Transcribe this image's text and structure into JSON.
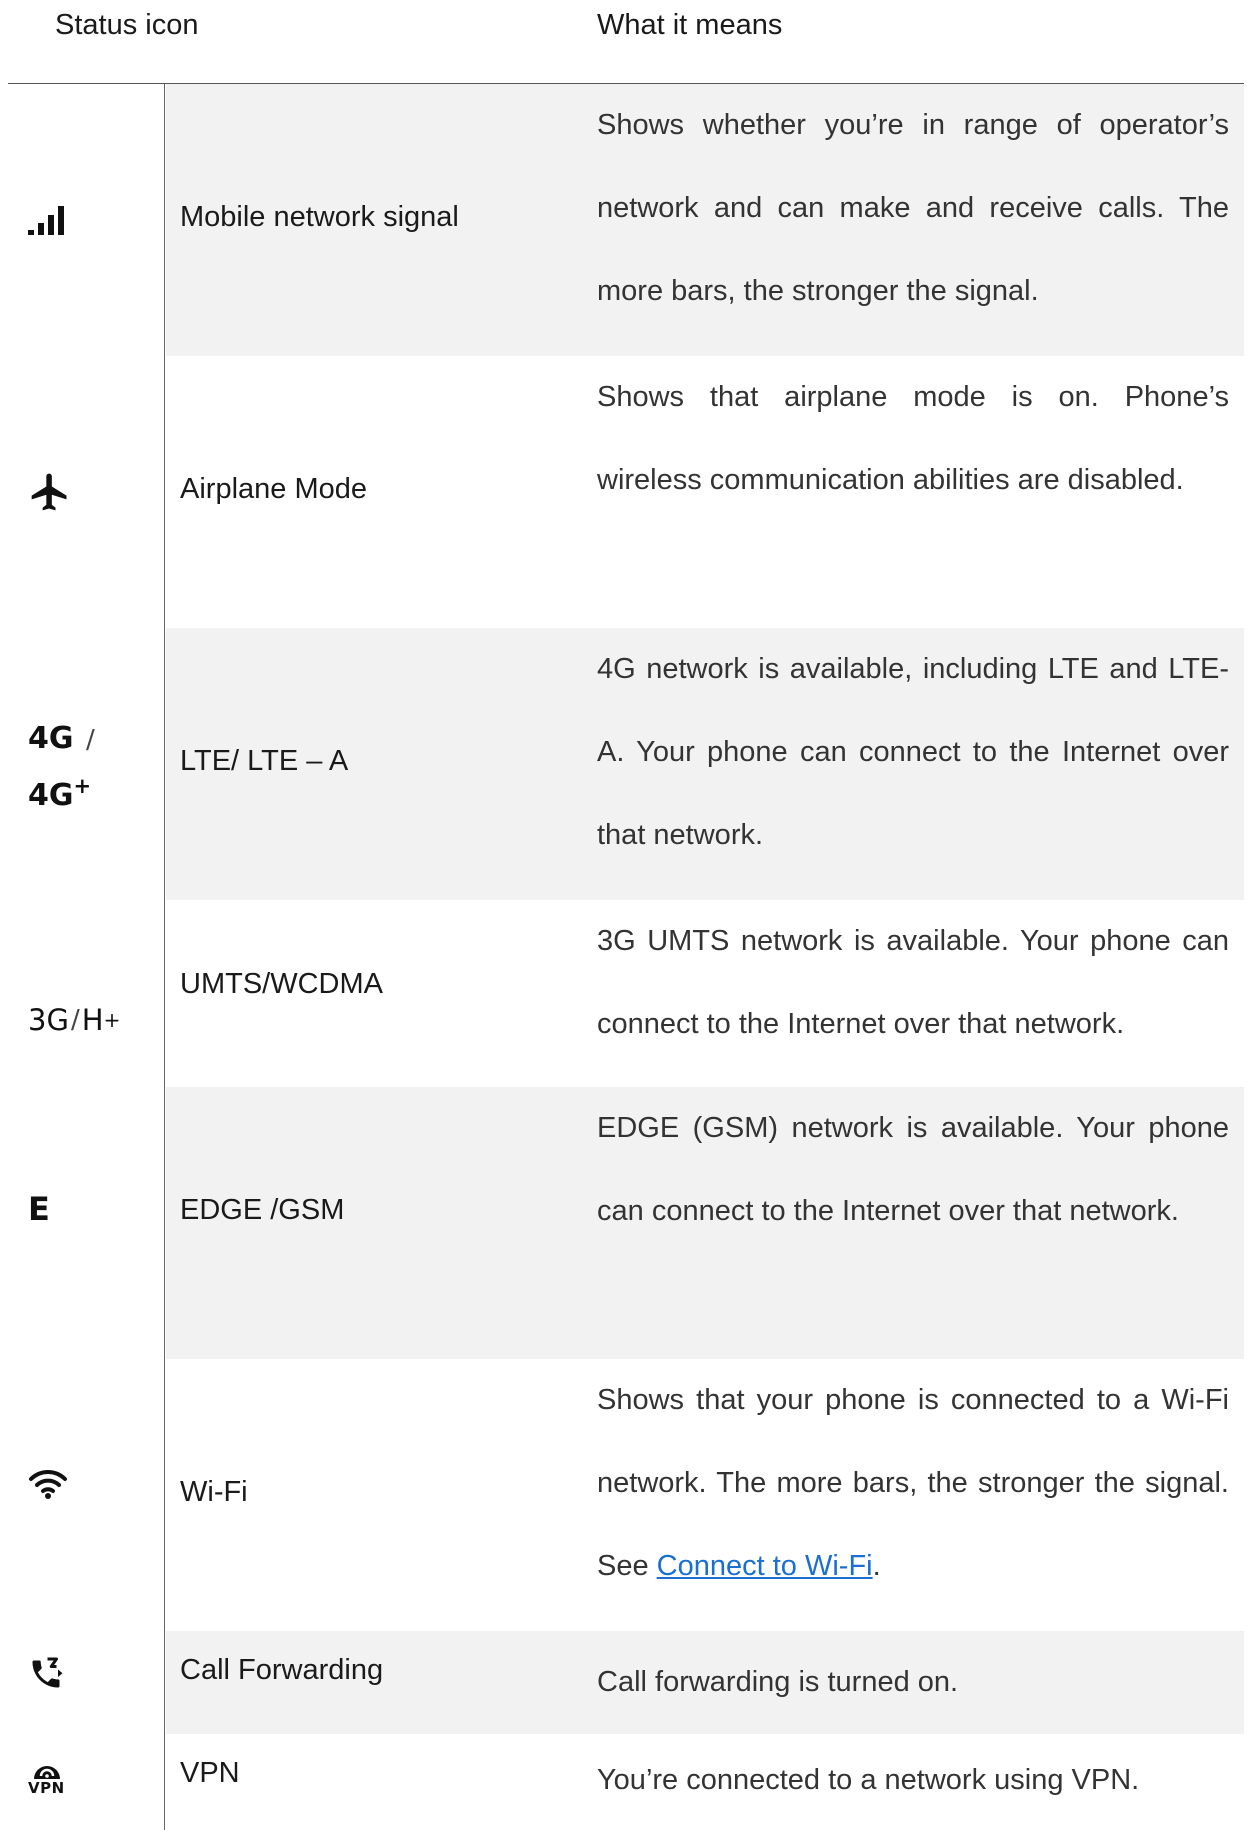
{
  "table": {
    "header": {
      "icon_col": "Status icon",
      "meaning_col": "What it means"
    },
    "rows": [
      {
        "icon": "signal-bars-icon",
        "name": "Mobile network signal",
        "desc": "Shows whether you’re in range of operator’s network and can make and receive calls. The more bars, the stronger the signal."
      },
      {
        "icon": "airplane-icon",
        "name": "Airplane Mode",
        "desc": "Shows that airplane mode is on. Phone’s wireless communication abilities are disabled."
      },
      {
        "icon": "4g-icon",
        "icon_text_a": "4G",
        "icon_sep": "/",
        "icon_text_b": "4G",
        "icon_sup": "+",
        "name": "LTE/ LTE – A",
        "desc": "4G network is available, including LTE and LTE-A. Your phone can connect to the Internet over that network."
      },
      {
        "icon": "3g-icon",
        "icon_text_a": "3G",
        "icon_sep": "/",
        "icon_text_b": "H",
        "icon_sup": "+",
        "name": "UMTS/WCDMA",
        "desc": "3G UMTS network is available. Your phone can connect to the Internet over that network."
      },
      {
        "icon": "edge-icon",
        "icon_text": "E",
        "name": "EDGE /GSM",
        "desc": "EDGE (GSM) network is available. Your phone can connect to the Internet over that network."
      },
      {
        "icon": "wifi-icon",
        "name": "Wi-Fi",
        "desc": "Shows that your phone is connected to a Wi-Fi network. The more bars, the stronger the signal. See ",
        "link": "Connect to Wi-Fi",
        "desc_end": "."
      },
      {
        "icon": "call-forwarding-icon",
        "name": "Call Forwarding",
        "desc": "Call forwarding is turned on."
      },
      {
        "icon": "vpn-icon",
        "icon_text": "VPN",
        "name": "VPN",
        "desc": "You’re connected to a network using VPN."
      }
    ]
  }
}
